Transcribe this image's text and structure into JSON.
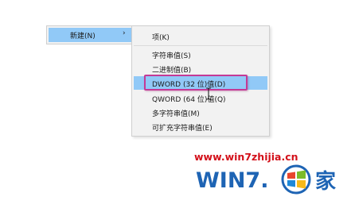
{
  "parent_menu": {
    "new_item": {
      "label": "新建(N)",
      "arrow": "›"
    }
  },
  "submenu": {
    "items": [
      {
        "label": "项(K)"
      },
      {
        "label": "字符串值(S)"
      },
      {
        "label": "二进制值(B)"
      },
      {
        "label": "DWORD (32 位)值(D)"
      },
      {
        "label": "QWORD (64 位)值(Q)"
      },
      {
        "label": "多字符串值(M)"
      },
      {
        "label": "可扩充字符串值(E)"
      }
    ],
    "highlighted_index": 3
  },
  "watermark": {
    "url": "www.win7zhijia.cn",
    "logo_text": "WIN7.之家",
    "logo_color": "#1e64b4"
  },
  "colors": {
    "menu_background": "#f2f2f2",
    "highlight": "#91c9f7",
    "callout": "#c43a96",
    "watermark_url": "#d3101a"
  },
  "icons": {
    "cursor": "text-cursor-icon",
    "windows_logo": "windows-logo-icon"
  }
}
